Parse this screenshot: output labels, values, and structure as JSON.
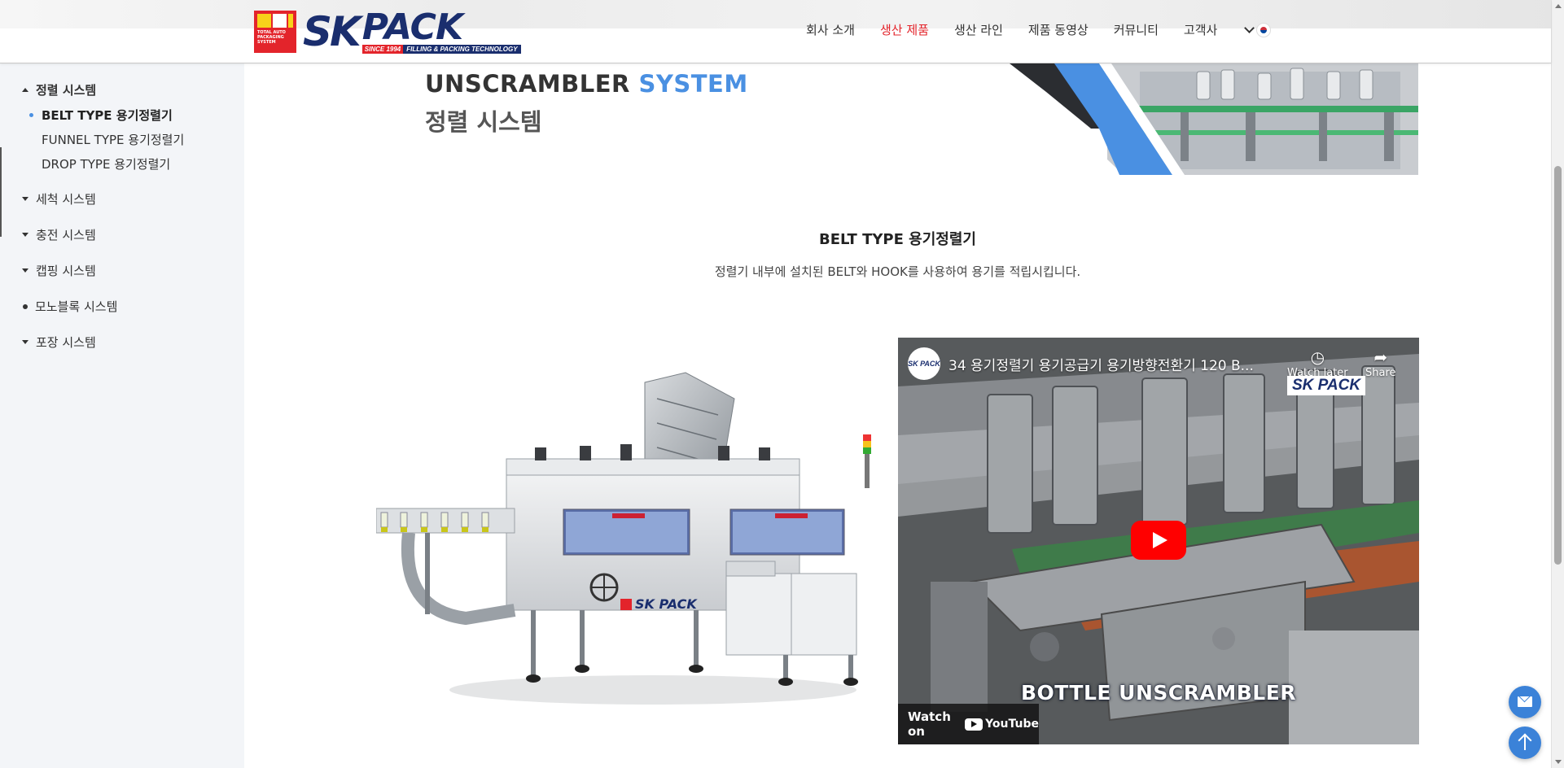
{
  "header": {
    "logo": {
      "brand_sk": "SK",
      "brand_pack": "PACK",
      "since": "SINCE 1994",
      "tagline": "FILLING & PACKING TECHNOLOGY",
      "box_text": "TOTAL AUTO PACKAGING SYSTEM"
    },
    "nav": [
      {
        "label": "회사 소개",
        "active": false
      },
      {
        "label": "생산 제품",
        "active": true
      },
      {
        "label": "생산 라인",
        "active": false
      },
      {
        "label": "제품 동영상",
        "active": false
      },
      {
        "label": "커뮤니티",
        "active": false
      },
      {
        "label": "고객사",
        "active": false
      }
    ]
  },
  "sidebar": {
    "groups": [
      {
        "label": "정렬 시스템",
        "expanded": true,
        "items": [
          {
            "label": "BELT TYPE 용기정렬기",
            "current": true
          },
          {
            "label": "FUNNEL TYPE 용기정렬기",
            "current": false
          },
          {
            "label": "DROP TYPE 용기정렬기",
            "current": false
          }
        ]
      },
      {
        "label": "세척 시스템",
        "expanded": false
      },
      {
        "label": "충전 시스템",
        "expanded": false
      },
      {
        "label": "캡핑 시스템",
        "expanded": false
      },
      {
        "label": "모노블록 시스템",
        "expanded": false
      },
      {
        "label": "포장 시스템",
        "expanded": false
      }
    ]
  },
  "hero": {
    "title_part1": "UNSCRAMBLER",
    "title_part2": "SYSTEM",
    "subtitle": "정렬 시스템"
  },
  "content": {
    "title": "BELT TYPE 용기정렬기",
    "description": "정렬기 내부에 설치된 BELT와 HOOK를 사용하여 용기를 적립시킵니다."
  },
  "video": {
    "title": "34 용기정렬기 용기공급기 용기방향전환기 120 B...",
    "watch_later": "Watch later",
    "share": "Share",
    "caption": "BOTTLE UNSCRAMBLER",
    "watch_on": "Watch on",
    "youtube": "YouTube",
    "overlay_logo": "SK PACK",
    "channel": "SK PACK"
  },
  "colors": {
    "accent": "#4a90e2",
    "nav_active": "#e3242b",
    "brand_navy": "#1a2e6e",
    "fab": "#3b82d8"
  }
}
